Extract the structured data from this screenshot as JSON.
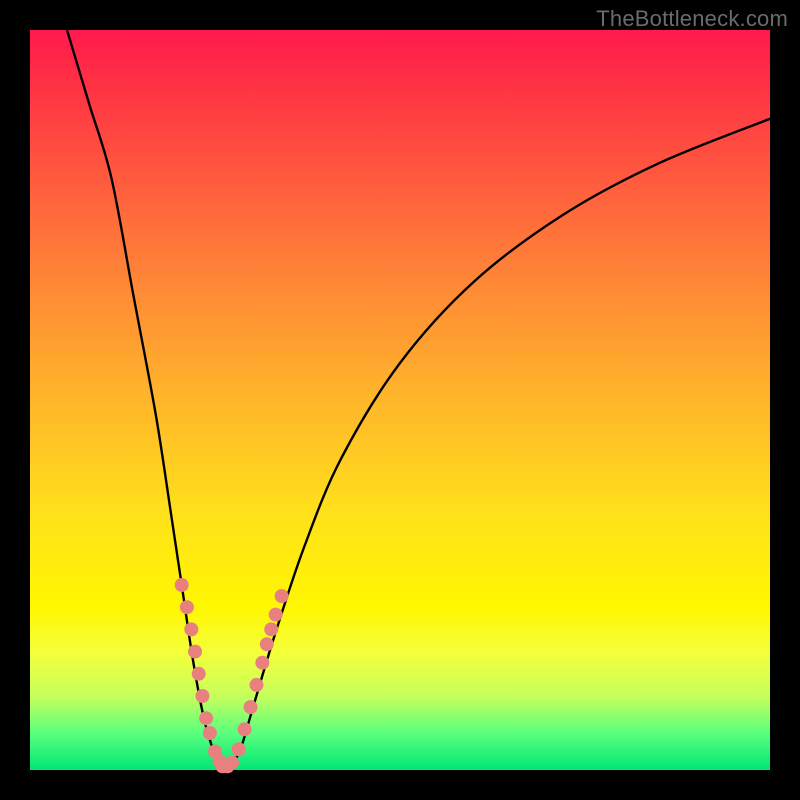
{
  "watermark": "TheBottleneck.com",
  "chart_data": {
    "type": "line",
    "title": "",
    "xlabel": "",
    "ylabel": "",
    "xlim": [
      0,
      100
    ],
    "ylim": [
      0,
      100
    ],
    "grid": false,
    "legend": false,
    "curve_left": {
      "description": "descending branch from top-left toward bottom notch",
      "points_xy": [
        [
          5,
          100
        ],
        [
          8,
          90
        ],
        [
          11,
          80
        ],
        [
          14,
          64
        ],
        [
          17,
          48
        ],
        [
          19,
          35
        ],
        [
          20.5,
          25
        ],
        [
          22,
          15
        ],
        [
          23.5,
          7
        ],
        [
          25,
          2
        ],
        [
          26,
          0
        ]
      ]
    },
    "curve_right": {
      "description": "ascending branch from bottom notch toward upper-right",
      "points_xy": [
        [
          27,
          0
        ],
        [
          28.5,
          3
        ],
        [
          30,
          8
        ],
        [
          33,
          18
        ],
        [
          37,
          30
        ],
        [
          42,
          42
        ],
        [
          50,
          55
        ],
        [
          60,
          66
        ],
        [
          72,
          75
        ],
        [
          85,
          82
        ],
        [
          100,
          88
        ]
      ]
    },
    "markers": {
      "description": "sample points near curve bottom",
      "radius_px": 7,
      "points_xy": [
        [
          20.5,
          25
        ],
        [
          21.2,
          22
        ],
        [
          21.8,
          19
        ],
        [
          22.3,
          16
        ],
        [
          22.8,
          13
        ],
        [
          23.3,
          10
        ],
        [
          23.8,
          7
        ],
        [
          24.3,
          5
        ],
        [
          25,
          2.5
        ],
        [
          25.6,
          1.2
        ],
        [
          26,
          0.5
        ],
        [
          26.7,
          0.5
        ],
        [
          27.3,
          1.0
        ],
        [
          28.2,
          2.8
        ],
        [
          29,
          5.5
        ],
        [
          29.8,
          8.5
        ],
        [
          30.6,
          11.5
        ],
        [
          31.4,
          14.5
        ],
        [
          32,
          17
        ],
        [
          32.6,
          19
        ],
        [
          33.2,
          21
        ],
        [
          34,
          23.5
        ]
      ]
    }
  }
}
